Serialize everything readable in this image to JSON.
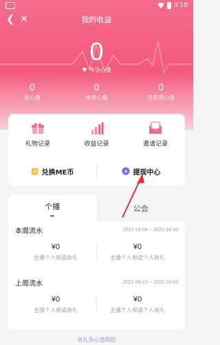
{
  "status": {
    "time": "3:18"
  },
  "header": {
    "title": "我的收益",
    "today_label": "今日心值",
    "today_value": "0"
  },
  "stats": [
    {
      "value": "0",
      "label": "总心值"
    },
    {
      "value": "0",
      "label": "本周心值"
    },
    {
      "value": "0",
      "label": "可使用心值"
    }
  ],
  "actions": {
    "items": [
      {
        "label": "礼物记录",
        "icon": "gift-icon"
      },
      {
        "label": "收益记录",
        "icon": "bar-chart-icon"
      },
      {
        "label": "邀请记录",
        "icon": "envelope-icon"
      }
    ],
    "exchange_label": "兑换ME币",
    "withdraw_label": "提现中心"
  },
  "tabs": [
    {
      "label": "个播",
      "active": true
    },
    {
      "label": "公会",
      "active": false
    }
  ],
  "this_week": {
    "title": "本周流水",
    "range": "2021-10-04 -- 2021-10-10",
    "left_amount": "¥0",
    "left_desc": "主播个人频道收礼",
    "right_amount": "¥0",
    "right_desc": "主播个人频道个人收礼"
  },
  "last_week": {
    "title": "上周流水",
    "range": "2021-09-27 -- 2021-10-03",
    "left_amount": "¥0",
    "left_desc": "主播个人频道收礼",
    "right_amount": "¥0",
    "right_desc": "主播个人频道个人收礼"
  },
  "footer": "收礼及心值规则",
  "colors": {
    "accent": "#f35a7b",
    "tab_underline": "#5f4bff",
    "arrow": "#e53030"
  }
}
